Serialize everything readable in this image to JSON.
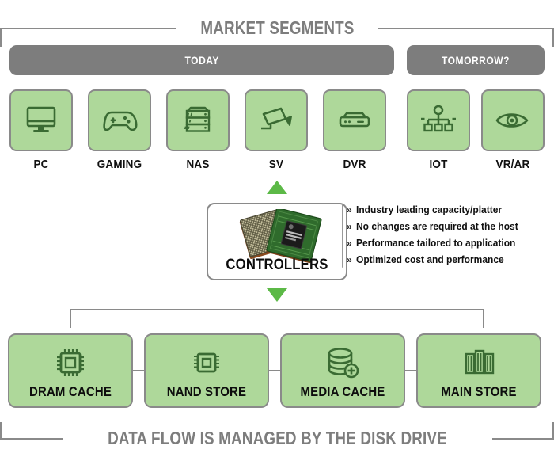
{
  "header": {
    "title": "MARKET SEGMENTS",
    "groups": [
      {
        "label": "TODAY"
      },
      {
        "label": "TOMORROW?"
      }
    ]
  },
  "segments": [
    {
      "label": "PC",
      "icon": "monitor-icon"
    },
    {
      "label": "GAMING",
      "icon": "gamepad-icon"
    },
    {
      "label": "NAS",
      "icon": "server-rack-icon"
    },
    {
      "label": "SV",
      "icon": "security-camera-icon"
    },
    {
      "label": "DVR",
      "icon": "set-top-box-icon"
    },
    {
      "label": "IOT",
      "icon": "network-tree-icon"
    },
    {
      "label": "VR/AR",
      "icon": "eye-icon"
    }
  ],
  "controllers": {
    "label": "CONTROLLERS",
    "image": "controller-chips-image",
    "bullet_marker": "»",
    "bullets": [
      "Industry leading capacity/platter",
      "No changes are required at the host",
      "Performance tailored to application",
      "Optimized cost and performance"
    ]
  },
  "storage": [
    {
      "label": "DRAM CACHE",
      "icon": "cpu-chip-icon"
    },
    {
      "label": "NAND STORE",
      "icon": "memory-chip-icon"
    },
    {
      "label": "MEDIA CACHE",
      "icon": "database-plus-icon"
    },
    {
      "label": "MAIN STORE",
      "icon": "disk-platters-icon"
    }
  ],
  "footer": {
    "title": "DATA FLOW IS MANAGED BY THE DISK DRIVE"
  },
  "colors": {
    "card_fill": "#aed89a",
    "card_border": "#8a8a8a",
    "icon_stroke": "#3a6b33",
    "bar_gray": "#7d7d7d",
    "arrow_green": "#5cb947",
    "title_gray": "#7d7d7d"
  }
}
